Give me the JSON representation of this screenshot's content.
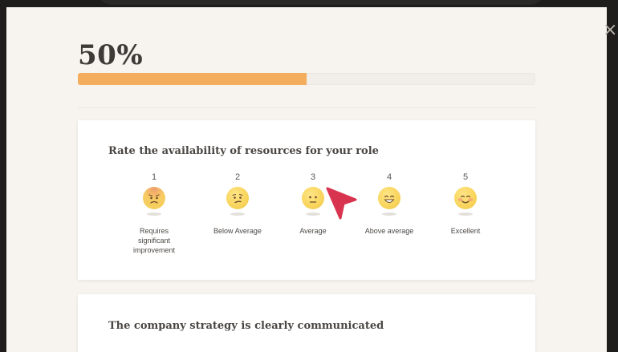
{
  "progress": {
    "label": "50%",
    "value": 0.5,
    "fill_color": "#f4ad5c"
  },
  "close_glyph": "×",
  "question1": {
    "text": "Rate the availability of resources for your role",
    "options": [
      {
        "number": "1",
        "label": "Requires significant improvement",
        "icon": "sad-face-icon"
      },
      {
        "number": "2",
        "label": "Below Average",
        "icon": "confused-face-icon"
      },
      {
        "number": "3",
        "label": "Average",
        "icon": "neutral-face-icon"
      },
      {
        "number": "4",
        "label": "Above average",
        "icon": "grinning-face-icon"
      },
      {
        "number": "5",
        "label": "Excellent",
        "icon": "smiling-blush-face-icon"
      }
    ]
  },
  "question2": {
    "text": "The company strategy is clearly communicated"
  },
  "cursor": {
    "color": "#d9344f",
    "icon": "pointer-cursor-icon"
  }
}
